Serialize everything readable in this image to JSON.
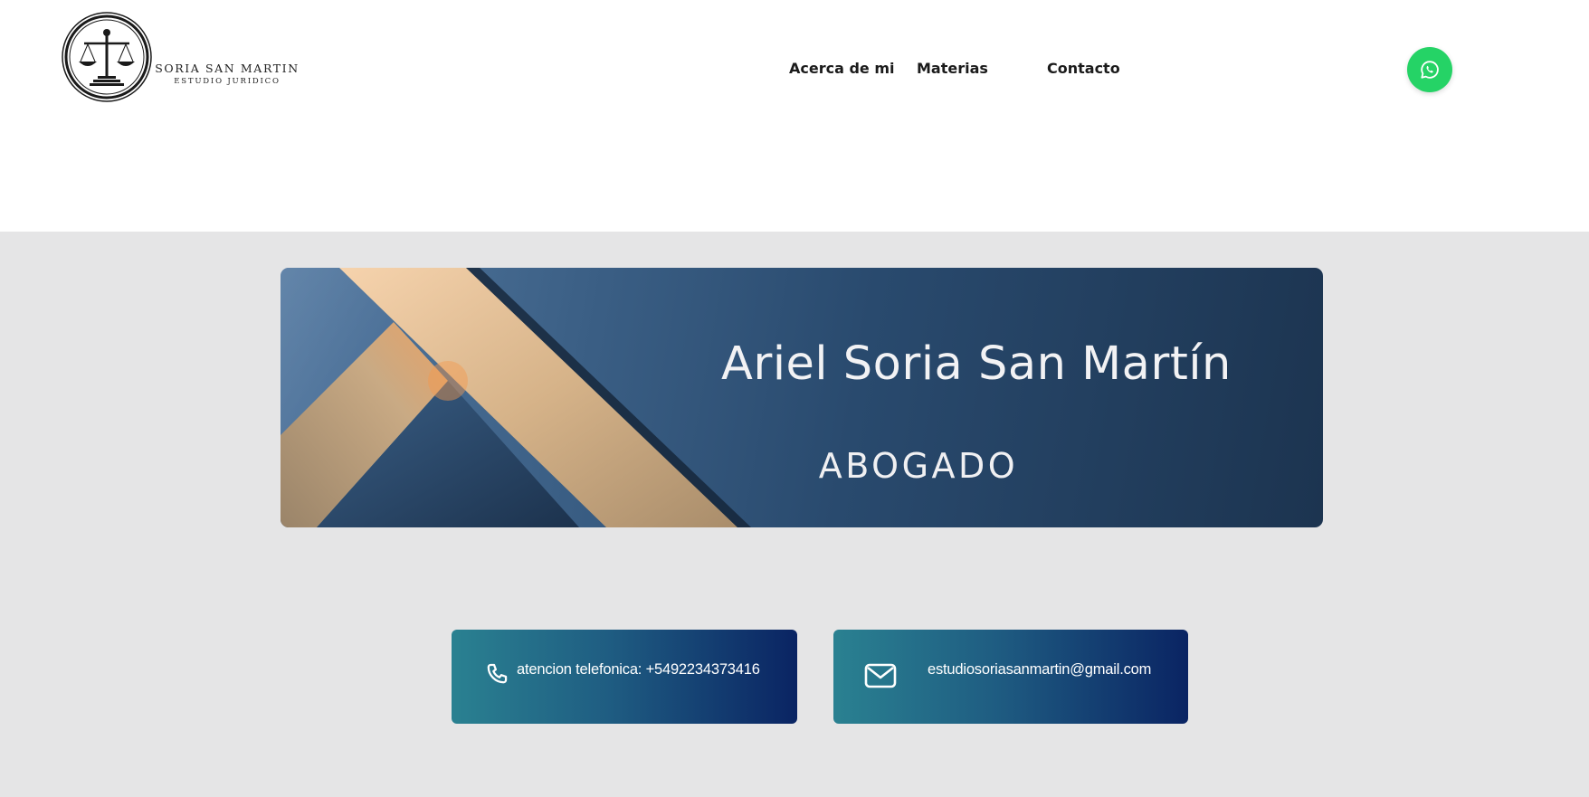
{
  "brand": {
    "name": "SORIA SAN MARTIN",
    "tagline": "ESTUDIO JURIDICO"
  },
  "nav": {
    "items": [
      {
        "label": "Acerca de mi"
      },
      {
        "label": "Materias"
      },
      {
        "label": "Contacto"
      }
    ]
  },
  "whatsapp": {
    "icon": "whatsapp-icon",
    "color": "#25d366"
  },
  "banner": {
    "name": "Ariel Soria San Martín",
    "role": "ABOGADO"
  },
  "contacts": {
    "phone": {
      "icon": "phone-icon",
      "label": "atencion telefonica: +5492234373416"
    },
    "email": {
      "icon": "mail-icon",
      "label": "estudiosoriasanmartin@gmail.com"
    }
  },
  "colors": {
    "page_bg": "#e5e5e6",
    "card_gradient_start": "#2a8191",
    "card_gradient_end": "#0a2463"
  }
}
